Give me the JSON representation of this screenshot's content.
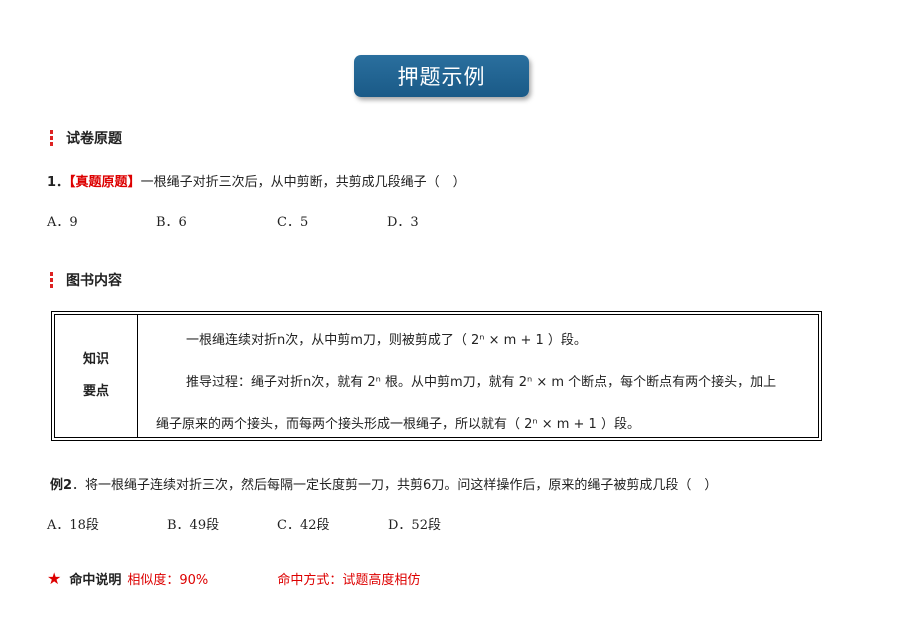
{
  "banner": {
    "title": "押题示例"
  },
  "section1": {
    "title": "试卷原题"
  },
  "q1": {
    "number": "1．",
    "tag": "【真题原题】",
    "text": "一根绳子对折三次后，从中剪断，共剪成几段绳子（　）",
    "options": [
      "A．9",
      "B．6",
      "C．5",
      "D．3"
    ]
  },
  "section2": {
    "title": "图书内容"
  },
  "knowledge": {
    "label_line1": "知识",
    "label_line2": "要点",
    "line1": "一根绳连续对折n次，从中剪m刀，则被剪成了（ 2ⁿ × m + 1 ）段。",
    "line2": "推导过程：绳子对折n次，就有 2ⁿ 根。从中剪m刀，就有 2ⁿ × m 个断点，每个断点有两个接头，加上",
    "line3": "绳子原来的两个接头，而每两个接头形成一根绳子，所以就有（ 2ⁿ × m + 1 ）段。"
  },
  "example2": {
    "label": "例2",
    "text": "．将一根绳子连续对折三次，然后每隔一定长度剪一刀，共剪6刀。问这样操作后，原来的绳子被剪成几段（　）",
    "options": [
      "A．18段",
      "B．49段",
      "C．42段",
      "D．52段"
    ]
  },
  "hit": {
    "label": "命中说明",
    "similarity": "相似度：90%",
    "method": "命中方式：试题高度相仿"
  },
  "colors": {
    "banner": "#1f6393",
    "accent_red": "#dd0000"
  }
}
